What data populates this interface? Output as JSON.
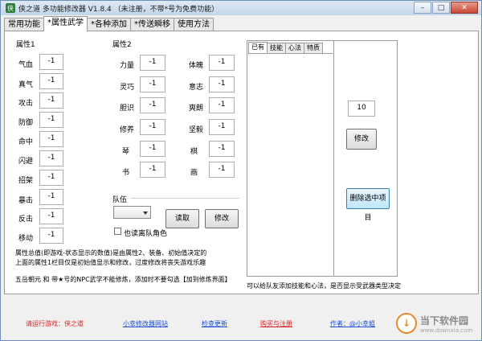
{
  "window": {
    "title": "侠之道  多功能修改器  V1.8.4  （未注册，不带*号为免费功能）"
  },
  "tabs": [
    {
      "label": "常用功能"
    },
    {
      "label": "*属性武学"
    },
    {
      "label": "*各种添加"
    },
    {
      "label": "*传送瞬移"
    },
    {
      "label": "使用方法"
    }
  ],
  "attr1": {
    "title": "属性1",
    "items": [
      {
        "label": "气血",
        "value": "-1"
      },
      {
        "label": "真气",
        "value": "-1"
      },
      {
        "label": "攻击",
        "value": "-1"
      },
      {
        "label": "防御",
        "value": "-1"
      },
      {
        "label": "命中",
        "value": "-1"
      },
      {
        "label": "闪避",
        "value": "-1"
      },
      {
        "label": "招架",
        "value": "-1"
      },
      {
        "label": "暴击",
        "value": "-1"
      },
      {
        "label": "反击",
        "value": "-1"
      },
      {
        "label": "移动",
        "value": "-1"
      }
    ]
  },
  "attr2": {
    "title": "属性2",
    "left": [
      {
        "label": "力量",
        "value": "-1"
      },
      {
        "label": "灵巧",
        "value": "-1"
      },
      {
        "label": "胆识",
        "value": "-1"
      },
      {
        "label": "修养",
        "value": "-1"
      },
      {
        "label": "琴",
        "value": "-1"
      },
      {
        "label": "书",
        "value": "-1"
      }
    ],
    "right": [
      {
        "label": "体魄",
        "value": "-1"
      },
      {
        "label": "意志",
        "value": "-1"
      },
      {
        "label": "爽朗",
        "value": "-1"
      },
      {
        "label": "坚毅",
        "value": "-1"
      },
      {
        "label": "棋",
        "value": "-1"
      },
      {
        "label": "画",
        "value": "-1"
      }
    ]
  },
  "team": {
    "title": "队伍",
    "read_label": "读取",
    "modify_label": "修改",
    "checkbox_label": "也读离队角色"
  },
  "skills": {
    "subtabs": [
      "已有",
      "技能",
      "心法",
      "特质"
    ],
    "qty_value": "10",
    "modify_label": "修改",
    "delete_label": "删除选中项目",
    "note": "可以给队友添加技能和心法，是否显示受武器类型决定"
  },
  "notes": {
    "line1": "属性总值(即游戏-状态显示的数值)是由属性2、装备、初始值决定的",
    "line2": "上面的属性1栏目仅是初始值显示和修改，过度修改将丧失游戏乐趣",
    "line3": "五岳朝元 和 带★号的NPC武学不能修炼，添加时不要勾选【加到修炼界面】"
  },
  "footer": {
    "run_game": "请运行游戏：侠之道",
    "website": "小幸修改器网站",
    "update": "检查更新",
    "buy": "购买与注册",
    "author": "作者：@小幸姐"
  },
  "watermark": {
    "line1": "当下软件园",
    "line2": "www.downxia.com"
  },
  "colors": {
    "link_red": "#e02020",
    "link_blue": "#1a4fd6"
  }
}
